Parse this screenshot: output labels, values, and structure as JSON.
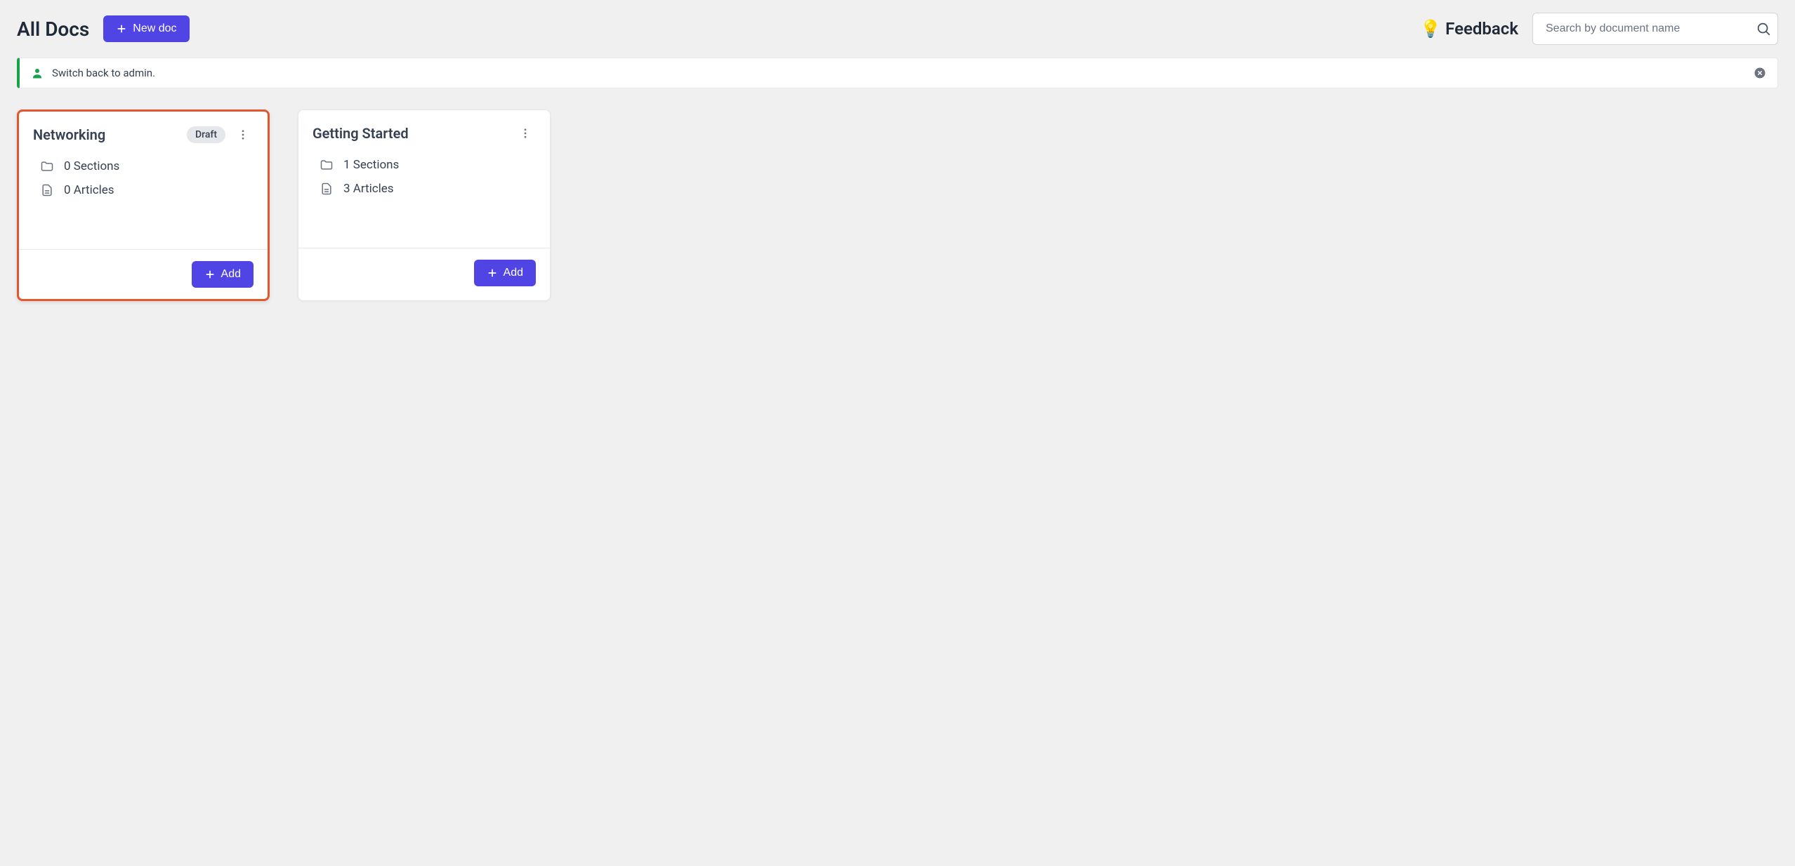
{
  "header": {
    "title": "All Docs",
    "new_doc_label": "New doc",
    "feedback_label": "Feedback",
    "search_placeholder": "Search by document name"
  },
  "alert": {
    "text": "Switch back to admin."
  },
  "cards": [
    {
      "title": "Networking",
      "badge": "Draft",
      "sections": "0 Sections",
      "articles": "0 Articles",
      "add_label": "Add",
      "highlighted": true
    },
    {
      "title": "Getting Started",
      "badge": "",
      "sections": "1 Sections",
      "articles": "3 Articles",
      "add_label": "Add",
      "highlighted": false
    }
  ]
}
